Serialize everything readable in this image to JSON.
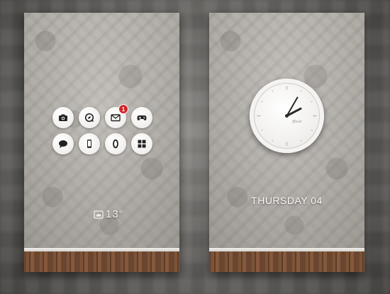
{
  "left_screen": {
    "apps": [
      {
        "icon": "camera-icon"
      },
      {
        "icon": "compass-icon"
      },
      {
        "icon": "mail-icon",
        "badge": "1"
      },
      {
        "icon": "gamepad-icon"
      },
      {
        "icon": "chat-icon"
      },
      {
        "icon": "phone-icon"
      },
      {
        "icon": "browser-icon"
      },
      {
        "icon": "grid-icon"
      }
    ],
    "weather": {
      "icon": "cloud-icon",
      "temperature": "13°"
    }
  },
  "right_screen": {
    "clock": {
      "hours": 2,
      "minutes": 5,
      "brand": "Ifficial"
    },
    "date": "THURSDAY 04"
  },
  "colors": {
    "badge": "#d2262a",
    "wood": "#6f4a32",
    "wallpaper": "#b6b2ac"
  }
}
